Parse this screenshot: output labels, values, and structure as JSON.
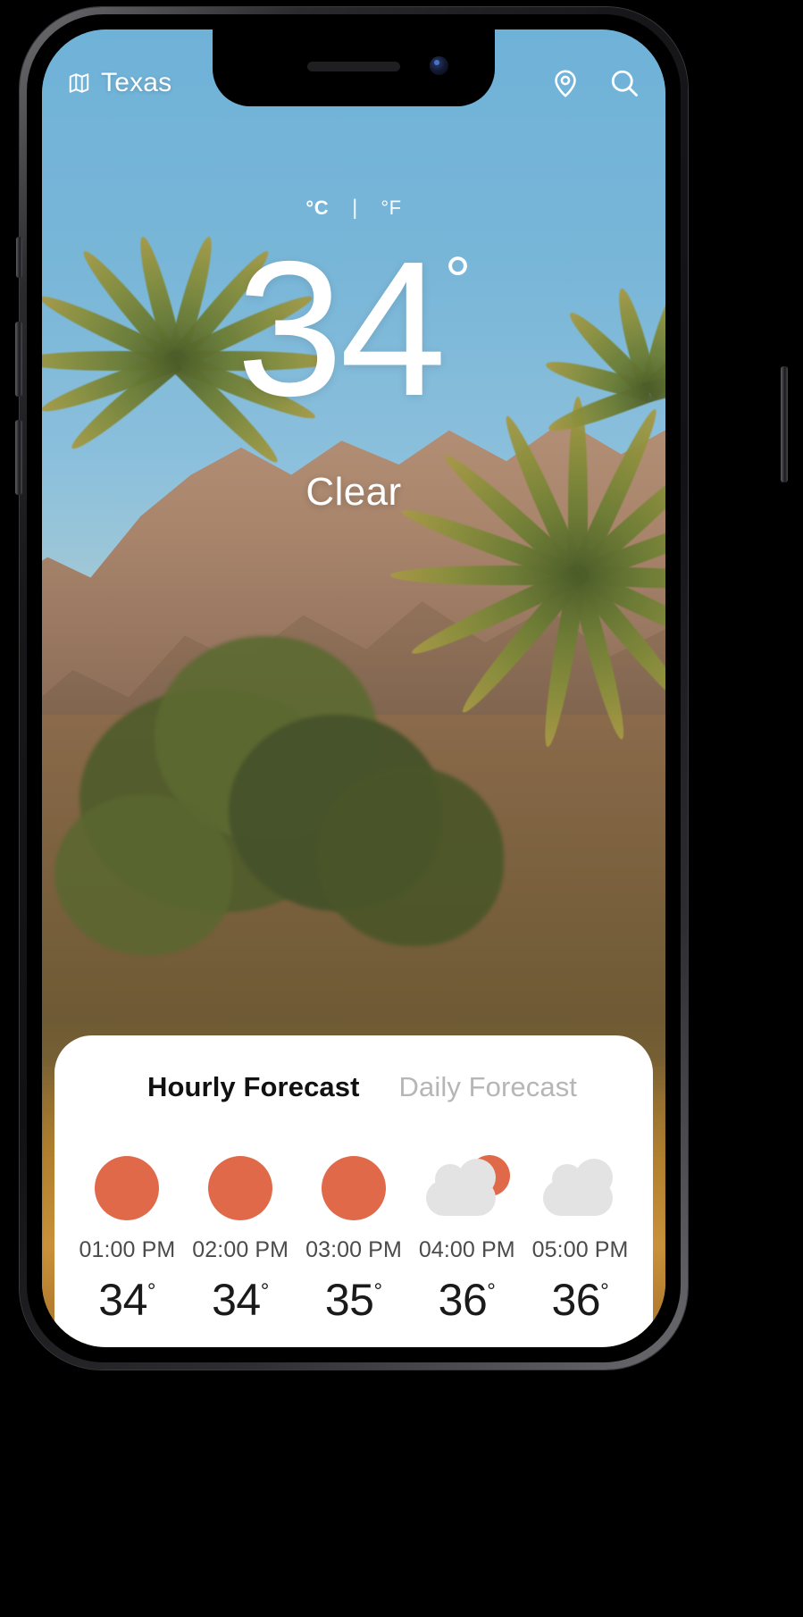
{
  "header": {
    "map_icon": "map-icon",
    "location": "Texas",
    "location_pin_icon": "location-pin-icon",
    "search_icon": "search-icon"
  },
  "units": {
    "celsius_label": "°C",
    "separator": "|",
    "fahrenheit_label": "°F",
    "selected": "°C"
  },
  "current": {
    "temperature": "34",
    "degree": "°",
    "condition": "Clear"
  },
  "forecast": {
    "tabs": [
      {
        "label": "Hourly Forecast",
        "active": true
      },
      {
        "label": "Daily Forecast",
        "active": false
      }
    ],
    "hours": [
      {
        "time": "01:00 PM",
        "temp": "34",
        "degree": "°",
        "icon": "sun-icon"
      },
      {
        "time": "02:00 PM",
        "temp": "34",
        "degree": "°",
        "icon": "sun-icon"
      },
      {
        "time": "03:00 PM",
        "temp": "35",
        "degree": "°",
        "icon": "sun-icon"
      },
      {
        "time": "04:00 PM",
        "temp": "36",
        "degree": "°",
        "icon": "sun-behind-cloud-icon"
      },
      {
        "time": "05:00 PM",
        "temp": "36",
        "degree": "°",
        "icon": "cloud-icon"
      }
    ]
  },
  "colors": {
    "sun_orange": "#e0694a",
    "cloud_gray": "#e3e3e3",
    "sky_blue": "#7ab5d6",
    "active_tab": "#111111",
    "inactive_tab": "#b6b6b6",
    "card_background": "#ffffff"
  }
}
